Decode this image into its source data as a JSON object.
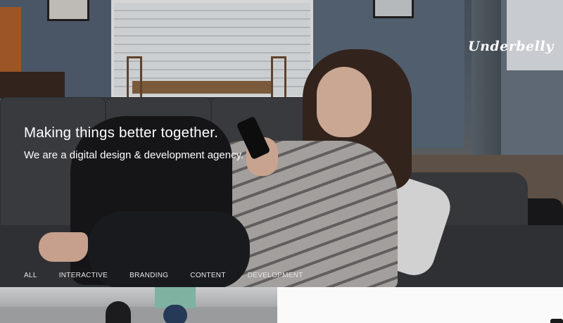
{
  "brand": {
    "logo_text": "Underbelly"
  },
  "hero": {
    "headline": "Making things better together.",
    "subline": "We are a digital design & development agency."
  },
  "filters": [
    {
      "label": "ALL"
    },
    {
      "label": "INTERACTIVE"
    },
    {
      "label": "BRANDING"
    },
    {
      "label": "CONTENT"
    },
    {
      "label": "DEVELOPMENT"
    }
  ],
  "colors": {
    "text": "#ffffff",
    "hero_overlay": "#1e1f22",
    "tile_light": "#fafafa"
  }
}
